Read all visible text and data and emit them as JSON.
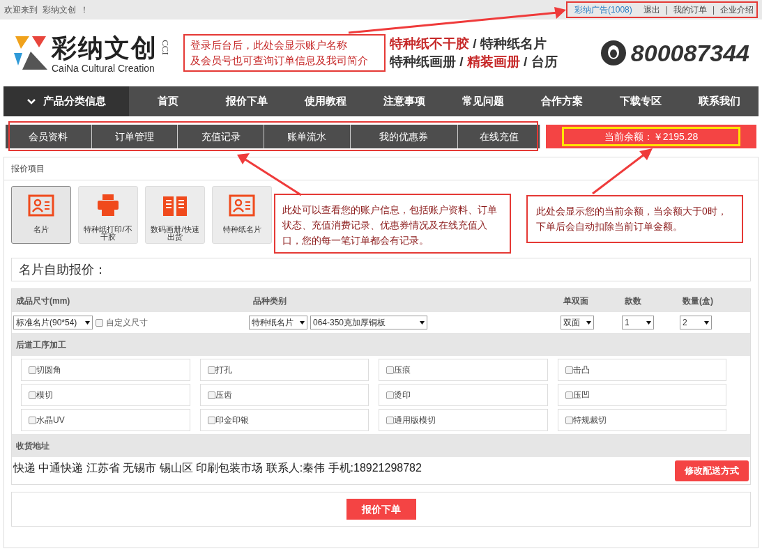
{
  "top_bar": {
    "greeting": "欢迎来到  彩纳文创  ！",
    "links": [
      {
        "text": "彩纳广告(1008)",
        "kind": "highlight"
      },
      {
        "text": "退出",
        "kind": "link"
      },
      {
        "text": "|",
        "kind": "separator"
      },
      {
        "text": "我的订单",
        "kind": "link"
      },
      {
        "text": "|",
        "kind": "separator"
      },
      {
        "text": "企业介绍",
        "kind": "link"
      }
    ]
  },
  "logo": {
    "name": "彩纳文创",
    "mark": "CCI",
    "english": "CaiNa Cultural Creation"
  },
  "header_note": [
    "登录后台后，此处会显示账户名称",
    "及会员号也可查询订单信息及我司简介"
  ],
  "slogan": [
    [
      {
        "text": "特种纸不干胶",
        "red": true
      },
      {
        "text": " / 特种纸名片",
        "red": false
      }
    ],
    [
      {
        "text": "特种纸画册",
        "red": false
      },
      {
        "text": " / ",
        "red": false
      },
      {
        "text": "精装画册",
        "red": true
      },
      {
        "text": " / 台历",
        "red": false
      }
    ]
  ],
  "phone": "800087344",
  "nav": [
    {
      "label": "产品分类信息",
      "selected": true
    },
    {
      "label": "首页",
      "selected": false
    },
    {
      "label": "报价下单",
      "selected": false
    },
    {
      "label": "使用教程",
      "selected": false
    },
    {
      "label": "注意事项",
      "selected": false
    },
    {
      "label": "常见问题",
      "selected": false
    },
    {
      "label": "合作方案",
      "selected": false
    },
    {
      "label": "下载专区",
      "selected": false
    },
    {
      "label": "联系我们",
      "selected": false
    }
  ],
  "account_tabs": [
    "会员资料",
    "订单管理",
    "充值记录",
    "账单流水",
    "我的优惠券",
    "在线充值"
  ],
  "balance": "当前余额：￥2195.28",
  "section_title": "报价项目",
  "products": [
    {
      "label": "名片",
      "kind": "card",
      "selected": true
    },
    {
      "label": "特种纸打印/不干胶",
      "kind": "printer",
      "selected": false
    },
    {
      "label": "数码画册/快速出货",
      "kind": "book",
      "selected": false
    },
    {
      "label": "特种纸名片",
      "kind": "card",
      "selected": false
    }
  ],
  "callouts": [
    "此处可以查看您的账户信息，包括账户资料、订单状态、充值消费记录、优惠券情况及在线充值入口，您的每一笔订单都会有记录。",
    "此处会显示您的当前余额，当余额大于0时，下单后会自动扣除当前订单金额。"
  ],
  "quote_title": "名片自助报价：",
  "form": {
    "columns": [
      "成品尺寸(mm)",
      "品种类别",
      "单双面",
      "款数",
      "数量(盒)"
    ],
    "size_select": "标准名片(90*54)",
    "custom_size": {
      "label": "自定义尺寸",
      "checked": false
    },
    "type_select": "特种纸名片",
    "paper_select": "064-350克加厚铜板",
    "sides_select": "双面",
    "styles_select": "1",
    "quantity_select": "2"
  },
  "postpress": {
    "title": "后道工序加工",
    "options": [
      {
        "label": "切圆角",
        "checked": false
      },
      {
        "label": "打孔",
        "checked": false
      },
      {
        "label": "压痕",
        "checked": false
      },
      {
        "label": "击凸",
        "checked": false
      },
      {
        "label": "模切",
        "checked": false
      },
      {
        "label": "压齿",
        "checked": false
      },
      {
        "label": "烫印",
        "checked": false
      },
      {
        "label": "压凹",
        "checked": false
      },
      {
        "label": "水晶UV",
        "checked": false
      },
      {
        "label": "印金印银",
        "checked": false
      },
      {
        "label": "通用版模切",
        "checked": false
      },
      {
        "label": "特规裁切",
        "checked": false
      }
    ]
  },
  "shipping": {
    "title": "收货地址",
    "address": "快递 中通快递 江苏省 无锡市 锡山区 印刷包装市场 联系人:秦伟 手机:18921298782",
    "button": "修改配送方式"
  },
  "submit": "报价下单"
}
